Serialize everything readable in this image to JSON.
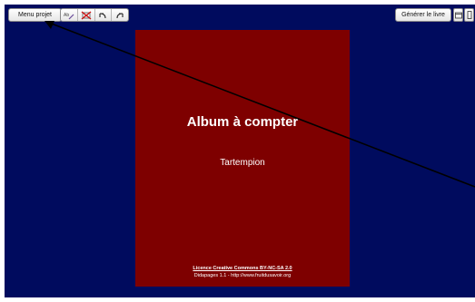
{
  "toolbar": {
    "menu_label": "Menu projet",
    "tools": [
      {
        "icon": "edit-text-icon"
      },
      {
        "icon": "delete-icon"
      },
      {
        "icon": "undo-icon"
      },
      {
        "icon": "redo-icon"
      }
    ],
    "generate_label": "Générer le livre",
    "right_icons": [
      "window-icon",
      "mobile-icon"
    ]
  },
  "book": {
    "title": "Album à compter",
    "author": "Tartempion",
    "license": "Licence Creative Commons BY-NC-SA 2.0",
    "credit": "Didapages 1.1 - http://www.fruitdusavoir.org"
  },
  "colors": {
    "background": "#000b5e",
    "cover": "#7e0000",
    "text": "#ffffff"
  }
}
